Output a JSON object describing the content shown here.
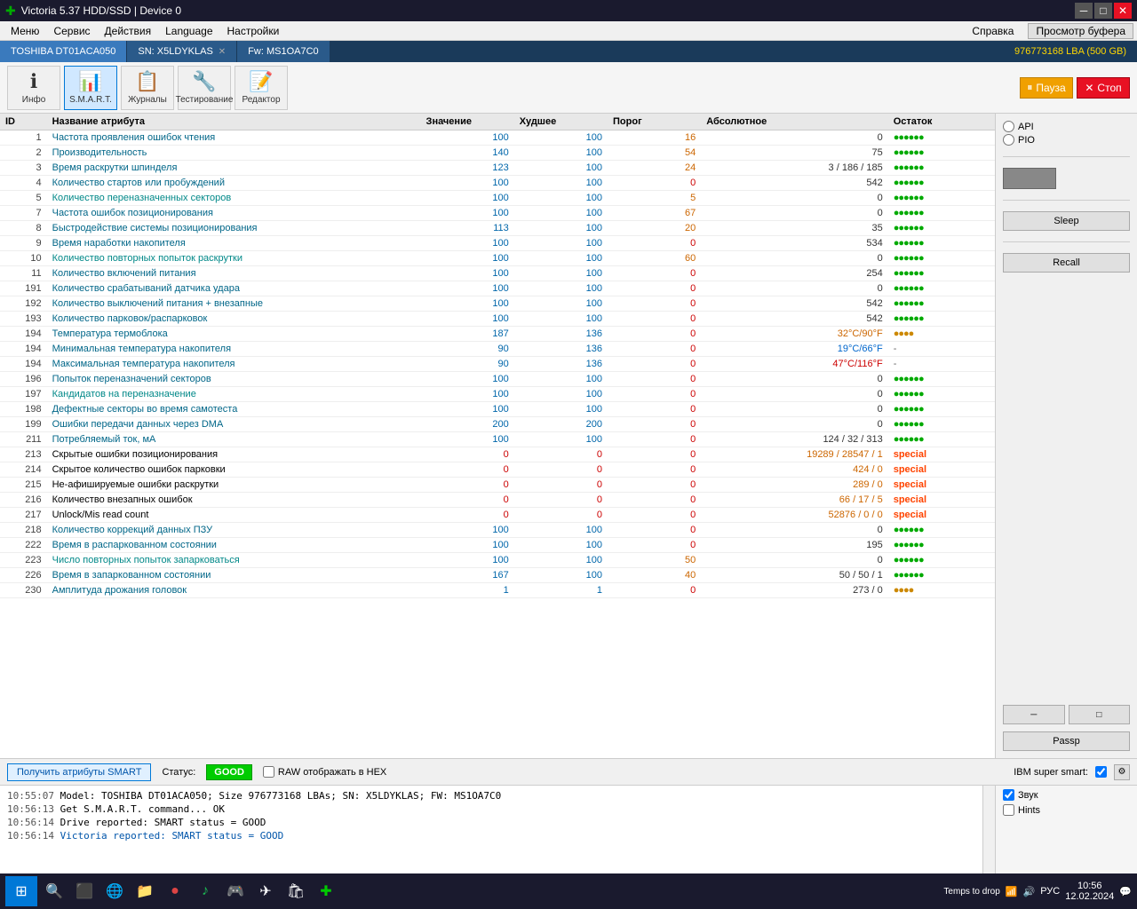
{
  "titleBar": {
    "icon": "✚",
    "title": "Victoria 5.37 HDD/SSD | Device 0",
    "minBtn": "─",
    "maxBtn": "□",
    "closeBtn": "✕"
  },
  "menuBar": {
    "items": [
      "Меню",
      "Сервис",
      "Действия",
      "Language",
      "Настройки"
    ],
    "right": [
      "Справка",
      "Просмотр буфера"
    ]
  },
  "tabBar": {
    "tab1": "TOSHIBA DT01ACA050",
    "tab2": "SN: X5LDYKLAS",
    "tab3": "Fw: MS1OA7C0",
    "lba": "976773168 LBA (500 GB)"
  },
  "toolbar": {
    "info": "Инфо",
    "smart": "S.M.A.R.T.",
    "journals": "Журналы",
    "testing": "Тестирование",
    "editor": "Редактор",
    "pause": "Пауза",
    "stop": "Стоп"
  },
  "tableHeaders": {
    "id": "ID",
    "name": "Название атрибута",
    "value": "Значение",
    "worst": "Худшее",
    "thresh": "Порог",
    "absolute": "Абсолютное",
    "status": "Остаток"
  },
  "rows": [
    {
      "id": "1",
      "name": "Частота проявления ошибок чтения",
      "value": "100",
      "worst": "100",
      "thresh": "16",
      "absolute": "0",
      "status": "dots",
      "statusClass": "dots-green"
    },
    {
      "id": "2",
      "name": "Производительность",
      "value": "140",
      "worst": "100",
      "thresh": "54",
      "absolute": "75",
      "status": "dots",
      "statusClass": "dots-green"
    },
    {
      "id": "3",
      "name": "Время раскрутки шпинделя",
      "value": "123",
      "worst": "100",
      "thresh": "24",
      "absolute": "3 / 186 / 185",
      "status": "dots",
      "statusClass": "dots-green"
    },
    {
      "id": "4",
      "name": "Количество стартов или пробуждений",
      "value": "100",
      "worst": "100",
      "thresh": "0",
      "absolute": "542",
      "status": "dots",
      "statusClass": "dots-green"
    },
    {
      "id": "5",
      "name": "Количество переназначенных секторов",
      "value": "100",
      "worst": "100",
      "thresh": "5",
      "absolute": "0",
      "status": "dots",
      "statusClass": "dots-green"
    },
    {
      "id": "7",
      "name": "Частота ошибок позиционирования",
      "value": "100",
      "worst": "100",
      "thresh": "67",
      "absolute": "0",
      "status": "dots",
      "statusClass": "dots-green"
    },
    {
      "id": "8",
      "name": "Быстродействие системы позиционирования",
      "value": "113",
      "worst": "100",
      "thresh": "20",
      "absolute": "35",
      "status": "dots",
      "statusClass": "dots-green"
    },
    {
      "id": "9",
      "name": "Время наработки накопителя",
      "value": "100",
      "worst": "100",
      "thresh": "0",
      "absolute": "534",
      "status": "dots",
      "statusClass": "dots-green"
    },
    {
      "id": "10",
      "name": "Количество повторных попыток раскрутки",
      "value": "100",
      "worst": "100",
      "thresh": "60",
      "absolute": "0",
      "status": "dots",
      "statusClass": "dots-green"
    },
    {
      "id": "11",
      "name": "Количество включений питания",
      "value": "100",
      "worst": "100",
      "thresh": "0",
      "absolute": "254",
      "status": "dots",
      "statusClass": "dots-green"
    },
    {
      "id": "191",
      "name": "Количество срабатываний датчика удара",
      "value": "100",
      "worst": "100",
      "thresh": "0",
      "absolute": "0",
      "status": "dots",
      "statusClass": "dots-green"
    },
    {
      "id": "192",
      "name": "Количество выключений питания + внезапные",
      "value": "100",
      "worst": "100",
      "thresh": "0",
      "absolute": "542",
      "status": "dots",
      "statusClass": "dots-green"
    },
    {
      "id": "193",
      "name": "Количество парковок/распарковок",
      "value": "100",
      "worst": "100",
      "thresh": "0",
      "absolute": "542",
      "status": "dots",
      "statusClass": "dots-green"
    },
    {
      "id": "194",
      "name": "Температура термоблока",
      "value": "187",
      "worst": "136",
      "thresh": "0",
      "absolute": "32°C/90°F",
      "status": "dots-warn",
      "statusClass": "dots-yellow"
    },
    {
      "id": "194",
      "name": "Минимальная температура накопителя",
      "value": "90",
      "worst": "136",
      "thresh": "0",
      "absolute": "19°C/66°F",
      "status": "—",
      "statusClass": ""
    },
    {
      "id": "194",
      "name": "Максимальная температура накопителя",
      "value": "90",
      "worst": "136",
      "thresh": "0",
      "absolute": "47°C/116°F",
      "status": "—",
      "statusClass": ""
    },
    {
      "id": "196",
      "name": "Попыток переназначений секторов",
      "value": "100",
      "worst": "100",
      "thresh": "0",
      "absolute": "0",
      "status": "dots",
      "statusClass": "dots-green"
    },
    {
      "id": "197",
      "name": "Кандидатов на переназначение",
      "value": "100",
      "worst": "100",
      "thresh": "0",
      "absolute": "0",
      "status": "dots",
      "statusClass": "dots-green"
    },
    {
      "id": "198",
      "name": "Дефектные секторы во время самотеста",
      "value": "100",
      "worst": "100",
      "thresh": "0",
      "absolute": "0",
      "status": "dots",
      "statusClass": "dots-green"
    },
    {
      "id": "199",
      "name": "Ошибки передачи данных через DMA",
      "value": "200",
      "worst": "200",
      "thresh": "0",
      "absolute": "0",
      "status": "dots",
      "statusClass": "dots-green"
    },
    {
      "id": "211",
      "name": "Потребляемый ток, мА",
      "value": "100",
      "worst": "100",
      "thresh": "0",
      "absolute": "124 / 32 / 313",
      "status": "dots",
      "statusClass": "dots-green"
    },
    {
      "id": "213",
      "name": "Скрытые ошибки позиционирования",
      "value": "0",
      "worst": "0",
      "thresh": "0",
      "absolute": "19289 / 28547 / 1",
      "status": "special",
      "statusClass": "special-text"
    },
    {
      "id": "214",
      "name": "Скрытое количество ошибок парковки",
      "value": "0",
      "worst": "0",
      "thresh": "0",
      "absolute": "424 / 0",
      "status": "special",
      "statusClass": "special-text"
    },
    {
      "id": "215",
      "name": "Не-афишируемые ошибки раскрутки",
      "value": "0",
      "worst": "0",
      "thresh": "0",
      "absolute": "289 / 0",
      "status": "special",
      "statusClass": "special-text"
    },
    {
      "id": "216",
      "name": "Количество внезапных ошибок",
      "value": "0",
      "worst": "0",
      "thresh": "0",
      "absolute": "66 / 17 / 5",
      "status": "special",
      "statusClass": "special-text"
    },
    {
      "id": "217",
      "name": "Unlock/Mis read count",
      "value": "0",
      "worst": "0",
      "thresh": "0",
      "absolute": "52876 / 0 / 0",
      "status": "special",
      "statusClass": "special-text"
    },
    {
      "id": "218",
      "name": "Количество коррекций данных ПЗУ",
      "value": "100",
      "worst": "100",
      "thresh": "0",
      "absolute": "0",
      "status": "dots",
      "statusClass": "dots-green"
    },
    {
      "id": "222",
      "name": "Время в распаркованном состоянии",
      "value": "100",
      "worst": "100",
      "thresh": "0",
      "absolute": "195",
      "status": "dots",
      "statusClass": "dots-green"
    },
    {
      "id": "223",
      "name": "Число повторных попыток запарковаться",
      "value": "100",
      "worst": "100",
      "thresh": "50",
      "absolute": "0",
      "status": "dots",
      "statusClass": "dots-green"
    },
    {
      "id": "226",
      "name": "Время в запаркованном состоянии",
      "value": "167",
      "worst": "100",
      "thresh": "40",
      "absolute": "50 / 50 / 1",
      "status": "dots",
      "statusClass": "dots-green"
    },
    {
      "id": "230",
      "name": "Амплитуда дрожания головок",
      "value": "1",
      "worst": "1",
      "thresh": "0",
      "absolute": "273 / 0",
      "status": "dots-warn",
      "statusClass": "dots-yellow"
    }
  ],
  "rightPanel": {
    "api": "API",
    "pio": "PIO",
    "sleep": "Sleep",
    "recall": "Recall",
    "passrp": "Passp"
  },
  "statusBar": {
    "getSmartBtn": "Получить атрибуты SMART",
    "statusLabel": "Статус:",
    "statusValue": "GOOD",
    "rawHexLabel": "RAW отображать в HEX",
    "ibmLabel": "IBM super smart:",
    "checkboxIBM": true
  },
  "log": {
    "lines": [
      {
        "time": "10:55:07",
        "text": "Model: TOSHIBA DT01ACA050; Size 976773168 LBAs; SN: X5LDYKLAS; FW: MS1OA7C0",
        "class": ""
      },
      {
        "time": "10:56:13",
        "text": "Get S.M.A.R.T. command... OK",
        "class": ""
      },
      {
        "time": "10:56:14",
        "text": "Drive reported: SMART status = GOOD",
        "class": ""
      },
      {
        "time": "10:56:14",
        "text": "Victoria reported: SMART status = GOOD",
        "class": "log-blue"
      }
    ]
  },
  "logRight": {
    "sound": "Звук",
    "hints": "Hints"
  },
  "taskbar": {
    "time": "10:56",
    "date": "12.02.2024",
    "tempsLabel": "Temps to drop",
    "lang": "РУС"
  }
}
